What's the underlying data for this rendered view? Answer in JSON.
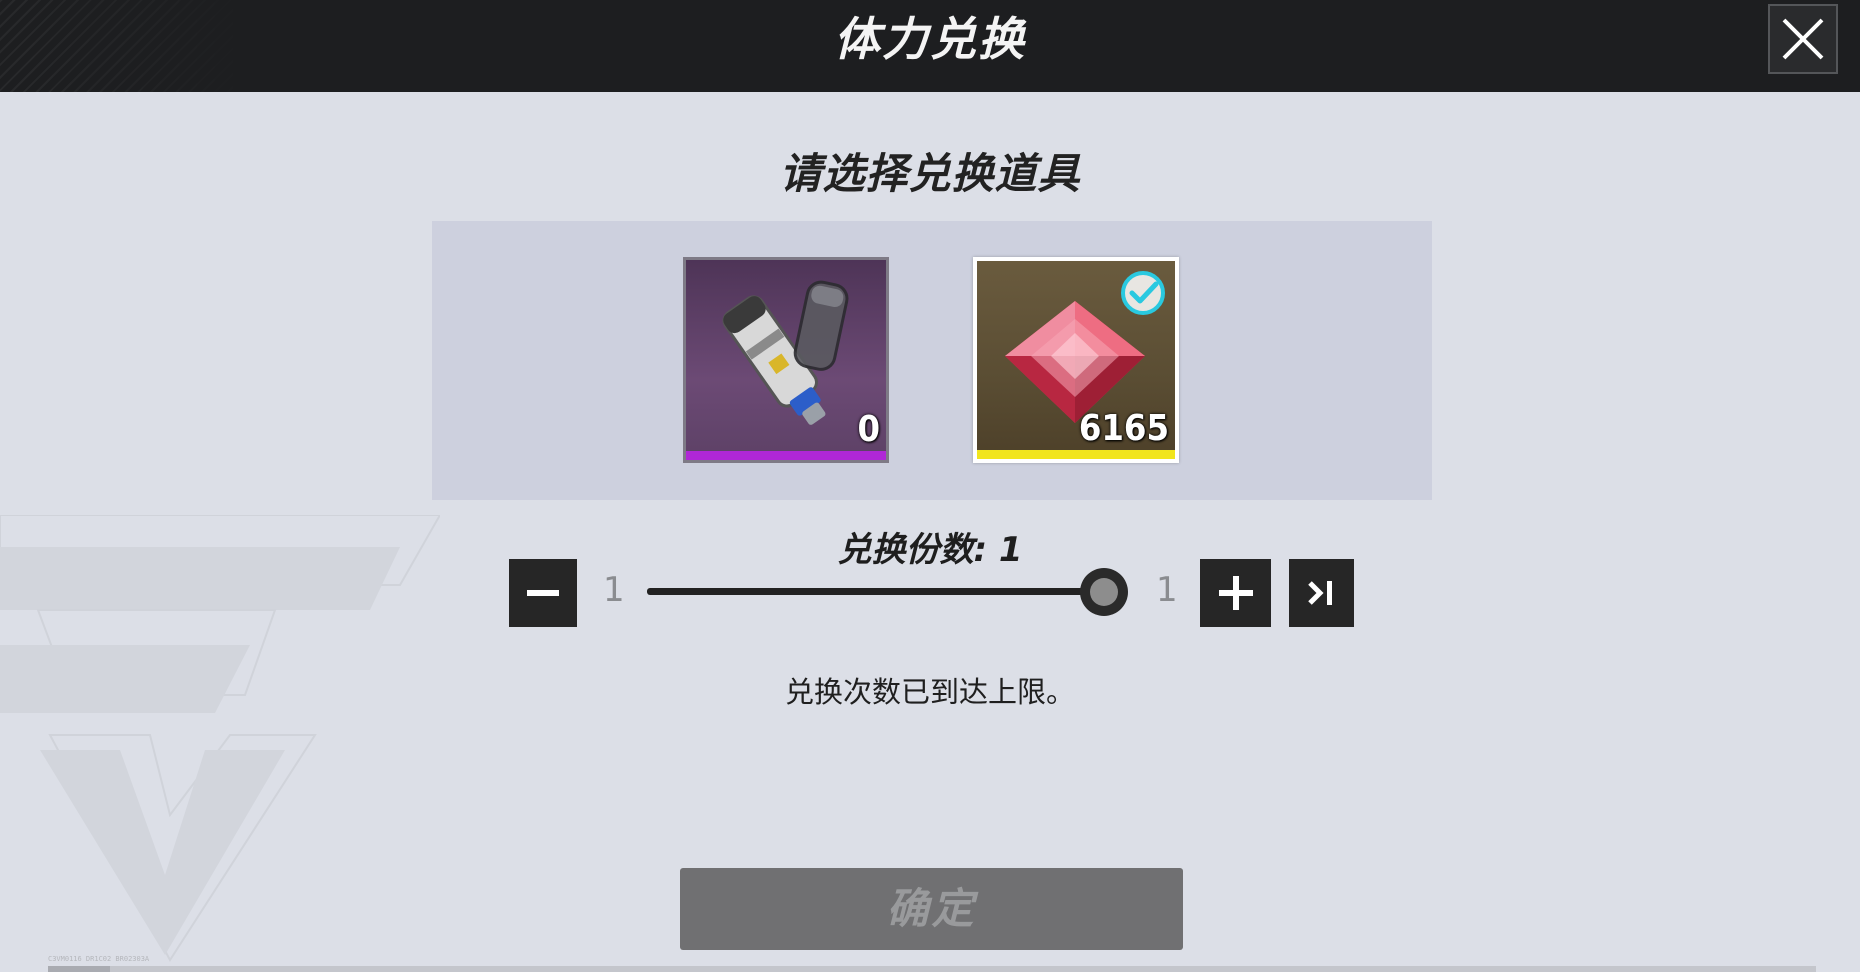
{
  "window": {
    "title": "体力兑换"
  },
  "main": {
    "heading": "请选择兑换道具",
    "items": [
      {
        "name": "injector",
        "count": "0",
        "rarity_color": "#b027d6",
        "selected": false
      },
      {
        "name": "red-crystal",
        "count": "6165",
        "rarity_color": "#f1e51c",
        "selected": true
      }
    ],
    "quantity": {
      "label": "兑换份数: 1",
      "min": "1",
      "max": "1",
      "value": 1
    },
    "limit_message": "兑换次数已到达上限。",
    "confirm_label": "确定",
    "tiny_id": "C3VM0116 DR1C02 BR02303A"
  },
  "colors": {
    "topbar": "#1d1e20",
    "background": "#dcdfe7",
    "panel": "#cdd0de",
    "confirm_disabled": "#707072",
    "check_accent": "#29c9e0"
  },
  "icons": [
    "close-icon",
    "minus-icon",
    "plus-icon",
    "skip-to-max-icon",
    "check-circle-icon"
  ]
}
